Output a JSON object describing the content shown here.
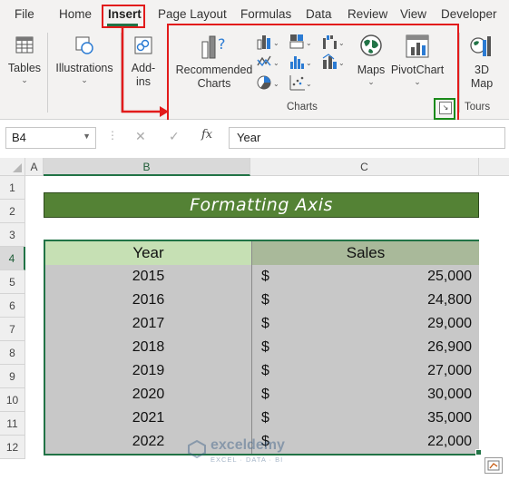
{
  "tabs": [
    "File",
    "Home",
    "Insert",
    "Page Layout",
    "Formulas",
    "Data",
    "Review",
    "View",
    "Developer"
  ],
  "ribbon": {
    "tables_label": "Tables",
    "illustrations_label": "Illustrations",
    "addins_line1": "Add-",
    "addins_line2": "ins",
    "recommended_line1": "Recommended",
    "recommended_line2": "Charts",
    "maps_label": "Maps",
    "pivotchart_label": "PivotChart",
    "map3d_line1": "3D",
    "map3d_line2": "Map",
    "charts_group_label": "Charts",
    "tours_group_label": "Tours"
  },
  "formula_bar": {
    "name_box": "B4",
    "fx": "fx",
    "content": "Year"
  },
  "grid": {
    "columns": [
      "A",
      "B",
      "C"
    ],
    "rows": [
      "1",
      "2",
      "3",
      "4",
      "5",
      "6",
      "7",
      "8",
      "9",
      "10",
      "11",
      "12"
    ],
    "title": "Formatting Axis",
    "headers": {
      "year": "Year",
      "sales": "Sales"
    },
    "currency_symbol": "$",
    "records": [
      {
        "year": "2015",
        "sales": "25,000"
      },
      {
        "year": "2016",
        "sales": "24,800"
      },
      {
        "year": "2017",
        "sales": "29,000"
      },
      {
        "year": "2018",
        "sales": "26,900"
      },
      {
        "year": "2019",
        "sales": "27,000"
      },
      {
        "year": "2020",
        "sales": "30,000"
      },
      {
        "year": "2021",
        "sales": "35,000"
      },
      {
        "year": "2022",
        "sales": "22,000"
      }
    ]
  },
  "watermark": {
    "name": "exceldemy",
    "tagline": "EXCEL · DATA · BI"
  },
  "colors": {
    "accent_green": "#217346",
    "title_fill": "#548235",
    "highlight_red": "#e21b1b",
    "highlight_green": "#1a8a1a"
  }
}
